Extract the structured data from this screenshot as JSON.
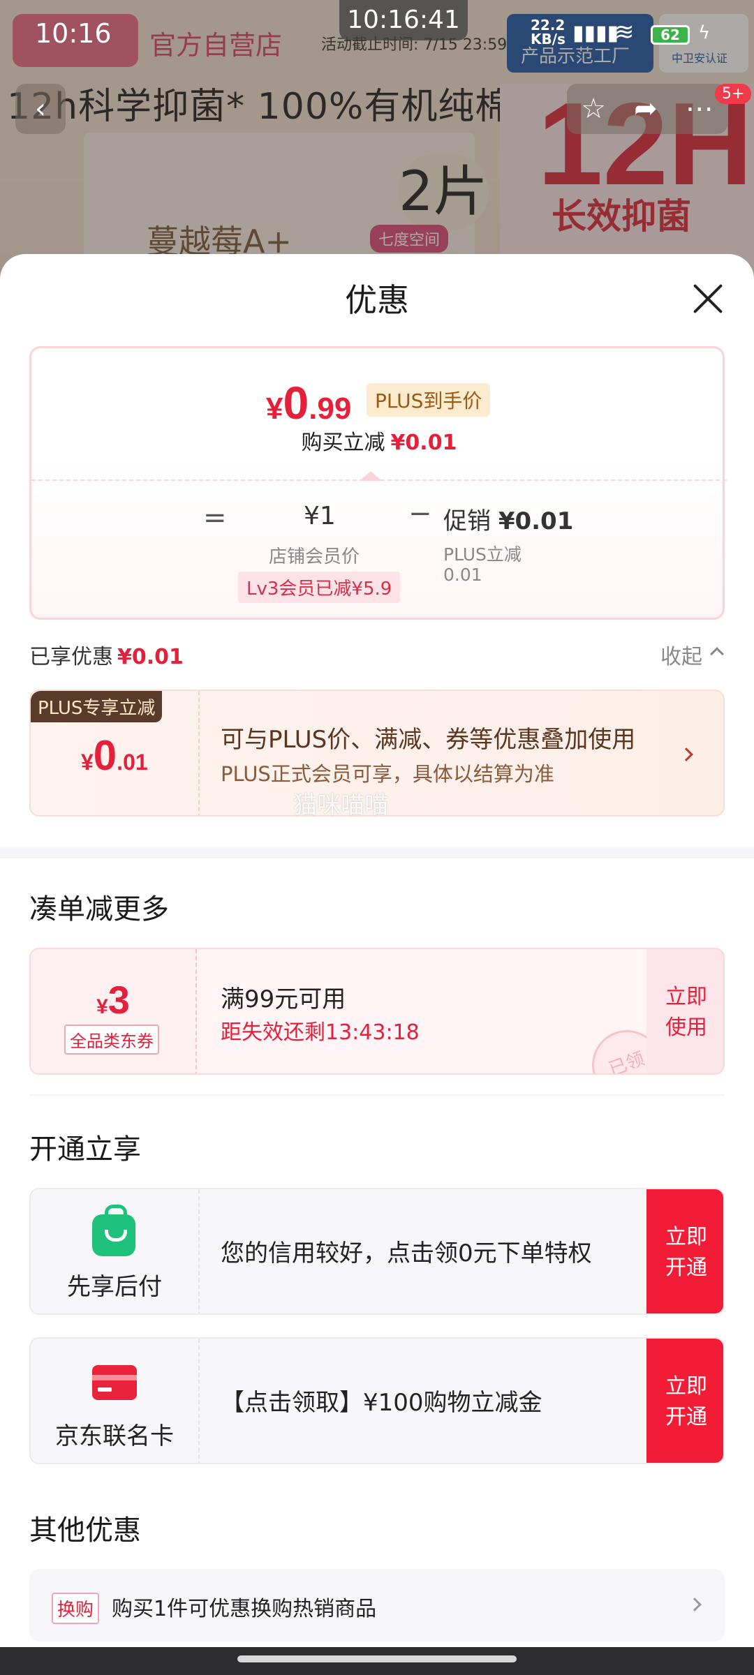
{
  "status_bar": {
    "time": "10:16",
    "clock": "10:16:41",
    "net_speed_value": "22.2",
    "net_speed_unit": "KB/s",
    "battery": "62",
    "signal_icon": "signal-icon",
    "wifi_icon": "wifi-icon"
  },
  "background_page": {
    "shop_title": "官方自营店",
    "deadline": "活动截止时间: 7/15 23:59",
    "headline": "12h科学抑菌* 100%有机纯棉**",
    "product_text": "蔓越莓A+",
    "count": "2片",
    "space_label": "七度空间",
    "big_text": "12H",
    "sub_text": "长效抑菌",
    "badge_text": "产品示范工厂",
    "badge_text2": "中卫安认证",
    "notification_count": "5+"
  },
  "sheet": {
    "title": "优惠",
    "price_card": {
      "yen": "¥",
      "price_int": "0",
      "price_dec": ".99",
      "plus_tag": "PLUS到手价",
      "cut_label": "购买立减",
      "cut_amount": "¥0.01",
      "eq": "=",
      "member_price": "¥1",
      "member_label": "店铺会员价",
      "lv3_tag": "Lv3会员已减¥5.9",
      "minus": "−",
      "promo_label": "促销",
      "promo_amount": "¥0.01",
      "plus_cut_label": "PLUS立减",
      "plus_cut_value": "0.01"
    },
    "enjoyed_label": "已享优惠",
    "enjoyed_amount": "¥0.01",
    "collapse_label": "收起",
    "plus_offer": {
      "tag": "PLUS专享立减",
      "yen": "¥",
      "int": "0",
      "dec": ".01",
      "line1": "可与PLUS价、满减、券等优惠叠加使用",
      "line2": "PLUS正式会员可享，具体以结算为准",
      "watermark": "猫咪喵喵"
    },
    "section_more": "凑单减更多",
    "coupon": {
      "yen": "¥",
      "amount": "3",
      "type": "全品类东券",
      "condition": "满99元可用",
      "countdown": "距失效还剩13:43:18",
      "action_line1": "立即",
      "action_line2": "使用",
      "stamp": "已领"
    },
    "section_open": "开通立享",
    "services": [
      {
        "name": "先享后付",
        "text": "您的信用较好，点击领0元下单特权",
        "action_line1": "立即",
        "action_line2": "开通"
      },
      {
        "name": "京东联名卡",
        "text": "【点击领取】¥100购物立减金",
        "action_line1": "立即",
        "action_line2": "开通"
      }
    ],
    "section_other": "其他优惠",
    "other": {
      "tag": "换购",
      "text": "购买1件可优惠换购热销商品"
    }
  }
}
